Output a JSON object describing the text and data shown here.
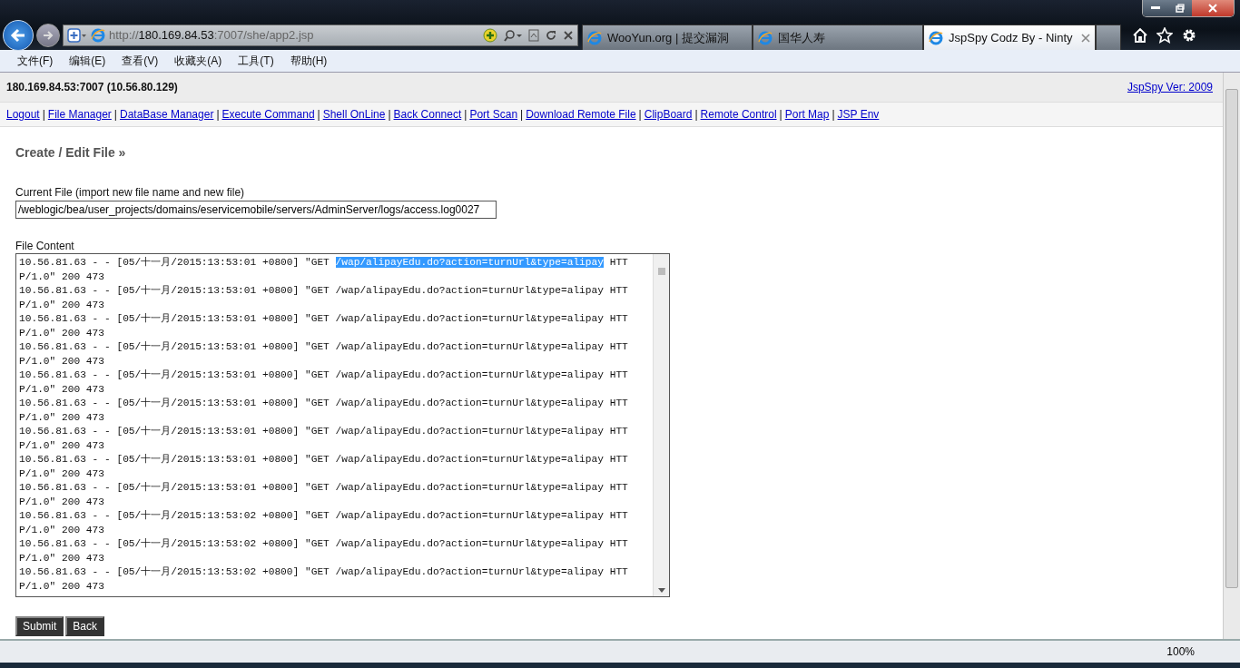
{
  "browser": {
    "address": {
      "scheme": "http://",
      "host": "180.169.84.53",
      "path": ":7007/she/app2.jsp"
    },
    "tabs": [
      {
        "title": "WooYun.org | 提交漏洞",
        "selected": false
      },
      {
        "title": "国华人寿",
        "selected": false
      },
      {
        "title": "JspSpy Codz By - Ninty",
        "selected": true
      }
    ],
    "menu": [
      "文件(F)",
      "编辑(E)",
      "查看(V)",
      "收藏夹(A)",
      "工具(T)",
      "帮助(H)"
    ]
  },
  "page": {
    "host": "180.169.84.53:7007 (10.56.80.129)",
    "version_link": "JspSpy Ver: 2009",
    "nav": [
      "Logout",
      "File Manager",
      "DataBase Manager",
      "Execute Command",
      "Shell OnLine",
      "Back Connect",
      "Port Scan",
      "Download Remote File",
      "ClipBoard",
      "Remote Control",
      "Port Map",
      "JSP Env"
    ],
    "nav_separator": "|",
    "heading": "Create / Edit File »",
    "current_file_label": "Current File (import new file name and new file)",
    "current_file": "/weblogic/bea/user_projects/domains/eservicemobile/servers/AdminServer/logs/access.log0027",
    "content_label": "File Content",
    "log": [
      {
        "prefix": "10.56.81.63 - - [05/十一月/2015:13:53:01 +0800] \"GET ",
        "path": "/wap/alipayEdu.do?action=turnUrl&type=alipay",
        "suffix": " HTTP/1.0\" 200 473",
        "selected": true
      },
      {
        "prefix": "10.56.81.63 - - [05/十一月/2015:13:53:01 +0800] \"GET ",
        "path": "/wap/alipayEdu.do?action=turnUrl&type=alipay",
        "suffix": " HTTP/1.0\" 200 473",
        "selected": false
      },
      {
        "prefix": "10.56.81.63 - - [05/十一月/2015:13:53:01 +0800] \"GET ",
        "path": "/wap/alipayEdu.do?action=turnUrl&type=alipay",
        "suffix": " HTTP/1.0\" 200 473",
        "selected": false
      },
      {
        "prefix": "10.56.81.63 - - [05/十一月/2015:13:53:01 +0800] \"GET ",
        "path": "/wap/alipayEdu.do?action=turnUrl&type=alipay",
        "suffix": " HTTP/1.0\" 200 473",
        "selected": false
      },
      {
        "prefix": "10.56.81.63 - - [05/十一月/2015:13:53:01 +0800] \"GET ",
        "path": "/wap/alipayEdu.do?action=turnUrl&type=alipay",
        "suffix": " HTTP/1.0\" 200 473",
        "selected": false
      },
      {
        "prefix": "10.56.81.63 - - [05/十一月/2015:13:53:01 +0800] \"GET ",
        "path": "/wap/alipayEdu.do?action=turnUrl&type=alipay",
        "suffix": " HTTP/1.0\" 200 473",
        "selected": false
      },
      {
        "prefix": "10.56.81.63 - - [05/十一月/2015:13:53:01 +0800] \"GET ",
        "path": "/wap/alipayEdu.do?action=turnUrl&type=alipay",
        "suffix": " HTTP/1.0\" 200 473",
        "selected": false
      },
      {
        "prefix": "10.56.81.63 - - [05/十一月/2015:13:53:01 +0800] \"GET ",
        "path": "/wap/alipayEdu.do?action=turnUrl&type=alipay",
        "suffix": " HTTP/1.0\" 200 473",
        "selected": false
      },
      {
        "prefix": "10.56.81.63 - - [05/十一月/2015:13:53:01 +0800] \"GET ",
        "path": "/wap/alipayEdu.do?action=turnUrl&type=alipay",
        "suffix": " HTTP/1.0\" 200 473",
        "selected": false
      },
      {
        "prefix": "10.56.81.63 - - [05/十一月/2015:13:53:02 +0800] \"GET ",
        "path": "/wap/alipayEdu.do?action=turnUrl&type=alipay",
        "suffix": " HTTP/1.0\" 200 473",
        "selected": false
      },
      {
        "prefix": "10.56.81.63 - - [05/十一月/2015:13:53:02 +0800] \"GET ",
        "path": "/wap/alipayEdu.do?action=turnUrl&type=alipay",
        "suffix": " HTTP/1.0\" 200 473",
        "selected": false
      },
      {
        "prefix": "10.56.81.63 - - [05/十一月/2015:13:53:02 +0800] \"GET ",
        "path": "/wap/alipayEdu.do?action=turnUrl&type=alipay",
        "suffix": " HTTP/1.0\" 200 473",
        "selected": false
      }
    ],
    "buttons": [
      "Submit",
      "Back"
    ]
  },
  "status_bar": {
    "zoom": "100%"
  }
}
